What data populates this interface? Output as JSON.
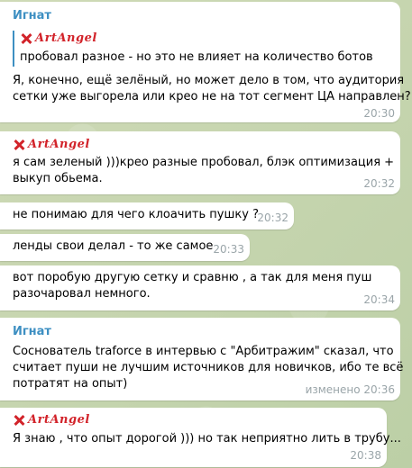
{
  "logo_text": "ArtAngel",
  "colors": {
    "sender": "#3d8fc2",
    "logo": "#d2232a",
    "time": "#9aa5a9",
    "bubble": "#ffffff",
    "background": "#c9d6b1"
  },
  "messages": [
    {
      "sender": "Игнат",
      "reply_text": "пробовал разное - но это не влияет на количество ботов",
      "lines": [
        "Я, конечно, ещё зелёный, но может дело в том, что аудитория",
        "сетки уже выгорела или крео не на тот сегмент ЦА направлен?"
      ],
      "time": "20:30"
    },
    {
      "lines": [
        "я сам зеленый )))крео разные пробовал, блэк оптимизация +",
        "выкуп обьема."
      ],
      "time": "20:32"
    },
    {
      "lines": [
        "не понимаю для чего клоачить пушку ?"
      ],
      "time": "20:32"
    },
    {
      "lines": [
        "ленды свои делал - то же самое"
      ],
      "time": "20:33"
    },
    {
      "lines": [
        "вот поробую другую сетку и сравню , а так для меня пуш",
        "разочаровал немного."
      ],
      "time": "20:34"
    },
    {
      "sender": "Игнат",
      "lines": [
        "Соснователь traforce в интервью с \"Арбитражим\" сказал, что",
        "считает пуши не лучшим источников для новичков, ибо те всё",
        "потратят на опыт)"
      ],
      "time": "изменено 20:36"
    },
    {
      "lines": [
        "Я знаю , что опыт дорогой ))) но так неприятно лить в трубу..."
      ],
      "time": "20:38"
    }
  ]
}
